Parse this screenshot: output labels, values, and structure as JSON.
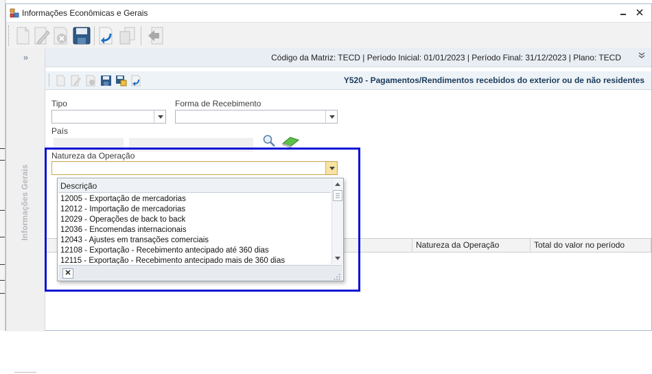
{
  "window": {
    "title": "Informações Econômicas e Gerais"
  },
  "main_toolbar": {
    "buttons": [
      "new-icon",
      "edit-icon",
      "delete-icon",
      "save-icon",
      "undo-icon",
      "copy-icon",
      "exit-icon"
    ]
  },
  "side_panel": {
    "label": "Informações Gerais"
  },
  "infobar": {
    "text": "Código da Matriz: TECD | Período Inicial: 01/01/2023 | Período Final: 31/12/2023 | Plano: TECD"
  },
  "subform": {
    "title": "Y520 - Pagamentos/Rendimentos recebidos do exterior ou de não residentes"
  },
  "form": {
    "tipo_label": "Tipo",
    "tipo_value": "",
    "forma_label": "Forma de Recebimento",
    "forma_value": "",
    "pais_label": "País",
    "natureza_label": "Natureza da Operação",
    "natureza_value": ""
  },
  "grid": {
    "columns": [
      "Natureza da Operação",
      "Total do valor no período"
    ]
  },
  "dropdown": {
    "header": "Descrição",
    "items": [
      "12005 - Exportação de mercadorias",
      "12012 - Importação de mercadorias",
      "12029 - Operações de back to back",
      "12036 - Encomendas internacionais",
      "12043 - Ajustes em transações comerciais",
      "12108 - Exportação - Recebimento antecipado até 360 dias",
      "12115 - Exportação - Recebimento antecipado mais de 360 dias"
    ]
  },
  "colors": {
    "highlight": "#0a10d6",
    "subform_title": "#1b3b5a",
    "active_arrow": "#f8e3a3"
  }
}
